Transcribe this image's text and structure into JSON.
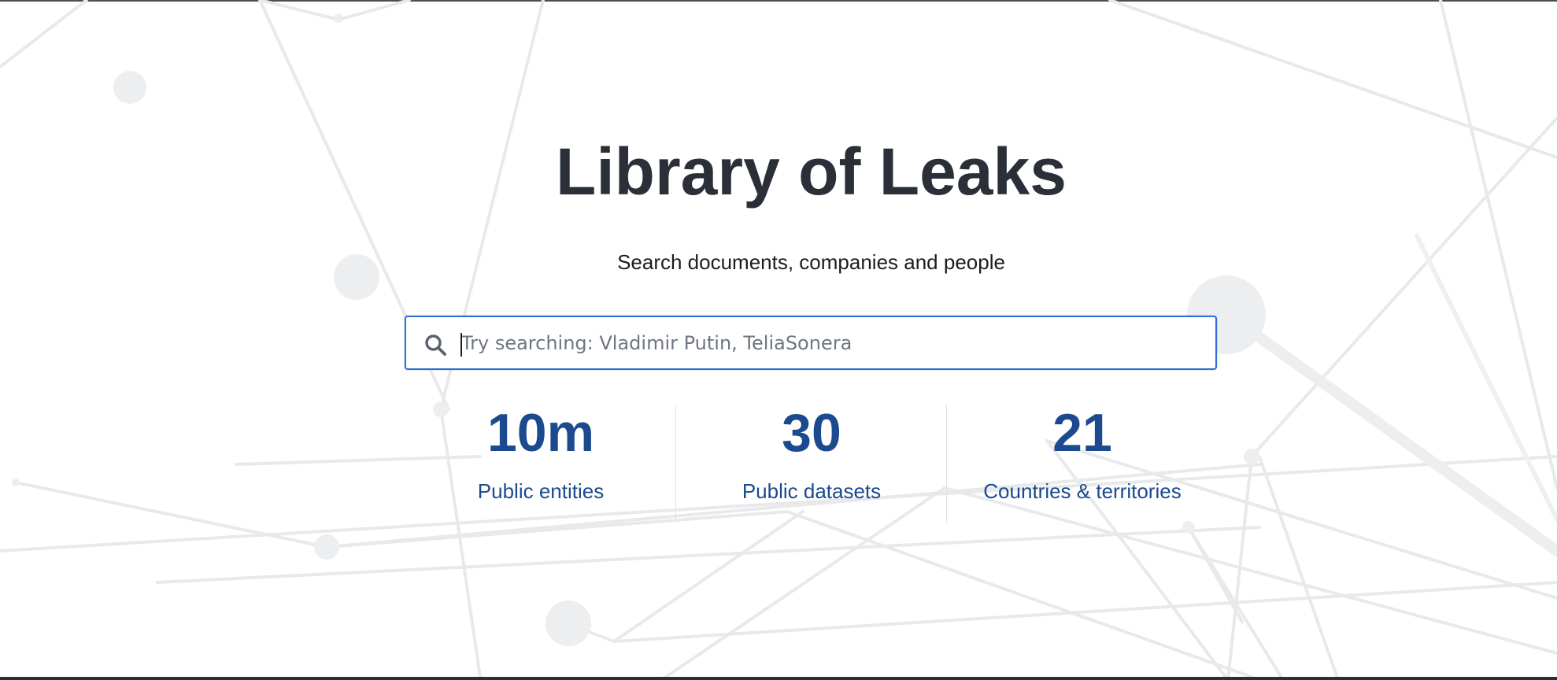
{
  "hero": {
    "title": "Library of Leaks",
    "subtitle": "Search documents, companies and people"
  },
  "search": {
    "placeholder": "Try searching: Vladimir Putin, TeliaSonera",
    "value": "",
    "icon": "search-icon"
  },
  "stats": [
    {
      "value": "10m",
      "label": "Public entities"
    },
    {
      "value": "30",
      "label": "Public datasets"
    },
    {
      "value": "21",
      "label": "Countries & territories"
    }
  ],
  "colors": {
    "title": "#2b3038",
    "stat_accent": "#1b4a8e",
    "search_border": "#2d6fd6",
    "network_lines": "#e6e7e9"
  }
}
